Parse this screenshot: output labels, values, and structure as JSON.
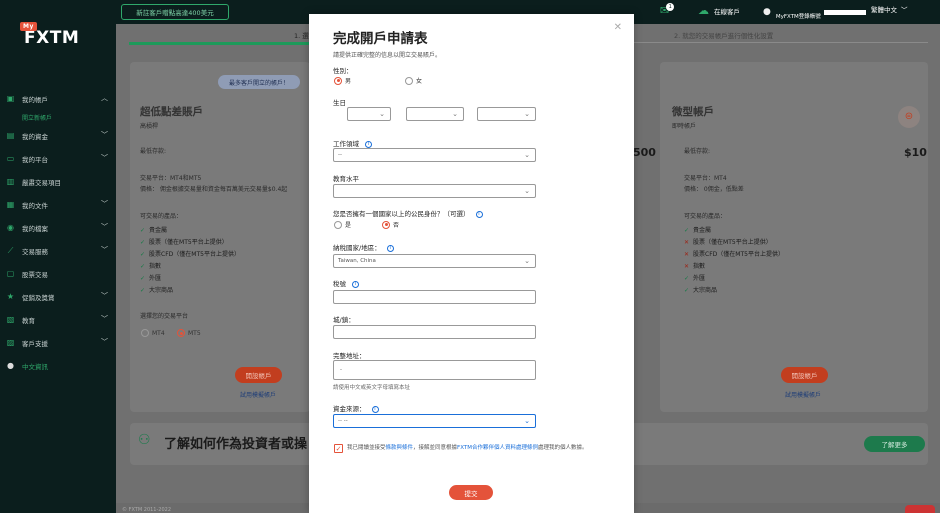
{
  "topbar": {
    "promo": "新註客戶贈點高達400美元",
    "notif_count": "1",
    "cabinet": "在線客戶",
    "user": "MyFXTM登錄帳號",
    "lang": "繁體中文"
  },
  "logo": {
    "badge": "My",
    "text": "FXTM"
  },
  "sidebar": {
    "items": [
      {
        "label": "我的帳戶",
        "icon": "accounts-icon"
      },
      {
        "label": "我的資金",
        "icon": "wallet-icon"
      },
      {
        "label": "我的平台",
        "icon": "platform-icon"
      },
      {
        "label": "嚴肅交易項目",
        "icon": "trade-icon"
      },
      {
        "label": "我的文件",
        "icon": "document-icon"
      },
      {
        "label": "我的檔案",
        "icon": "profile-icon"
      },
      {
        "label": "交易服務",
        "icon": "chart-icon"
      },
      {
        "label": "股票交易",
        "icon": "stocks-icon"
      },
      {
        "label": "促銷及獎賞",
        "icon": "star-icon"
      },
      {
        "label": "教育",
        "icon": "education-icon"
      },
      {
        "label": "客戶支援",
        "icon": "support-icon"
      },
      {
        "label": "中文資訊",
        "icon": "globe-icon"
      }
    ],
    "sub_item": "開立新帳戶"
  },
  "steps": {
    "left": "1. 選",
    "right": "2. 就您的交易帳戶進行個性化設置"
  },
  "card_left": {
    "tag": "最多客戶開立的帳戶！",
    "title": "超低點差賬戶",
    "subtitle": "高槓桿",
    "deposit_label": "最低存款:",
    "platform": "交易平台：MT4和MT5",
    "price": "價格： 佣金根據交易量和資金每百萬美元交易量$0.4起",
    "products_title": "可交易的產品：",
    "products": [
      "貴金屬",
      "股票（僅在MT5平台上提供）",
      "股票CFD（僅在MT5平台上提供）",
      "指數",
      "外匯",
      "大宗商品"
    ],
    "platform_choose": "選擇您的交易平台",
    "mt4": "MT4",
    "mt5": "MT5",
    "open_btn": "開設帳戶",
    "trial": "試用模擬帳戶"
  },
  "card_right": {
    "title": "微型帳戶",
    "subtitle": "即時帳戶",
    "deposit_label": "最低存款:",
    "deposit_value": "$10",
    "platform": "交易平台：MT4",
    "price": "價格： 0佣金，低點差",
    "products_title": "可交易的產品：",
    "products": [
      {
        "ok": true,
        "label": "貴金屬"
      },
      {
        "ok": false,
        "label": "股票（僅在MT5平台上提供）"
      },
      {
        "ok": false,
        "label": "股票CFD（僅在MT5平台上提供）"
      },
      {
        "ok": false,
        "label": "指數"
      },
      {
        "ok": true,
        "label": "外匯"
      },
      {
        "ok": true,
        "label": "大宗商品"
      }
    ],
    "open_btn": "開設帳戶",
    "trial": "試用模擬帳戶"
  },
  "middle_partial_value": "500",
  "learn": {
    "title": "了解如何作為投資者或操",
    "btn": "了解更多"
  },
  "footer": "© FXTM 2011-2022",
  "modal": {
    "title": "完成開戶申請表",
    "subtitle": "請提供正確完整的信息以開立交易賬戶。",
    "gender_label": "性別：",
    "male": "男",
    "female": "女",
    "birthday_label": "生日",
    "birthday_values": [
      "",
      "",
      ""
    ],
    "work_label": "工作領域",
    "work_value": "--",
    "edu_label": "教育水平",
    "edu_value": "",
    "citizen_label": "您是否擁有一個國家以上的公民身份？（可選）",
    "yes": "是",
    "no": "否",
    "tax_country_label": "納稅國家/地區：",
    "tax_country_value": "Taiwan, China",
    "tax_id_label": "稅號",
    "tax_id_value": "",
    "city_label": "城/鎮：",
    "address_label": "完整地址：",
    "address_value": "-",
    "address_hint": "請使用中文或英文字母填寫本址",
    "funds_label": "資金來源：",
    "funds_value": "-- --",
    "consent_a": "我已閱讀並接受",
    "consent_link1": "條款與條件",
    "consent_b": "，接解並同意根據",
    "consent_link2": "FXTM合作夥伴個人資料處理條例",
    "consent_c": "處理我的個人數據。",
    "submit": "提交"
  }
}
